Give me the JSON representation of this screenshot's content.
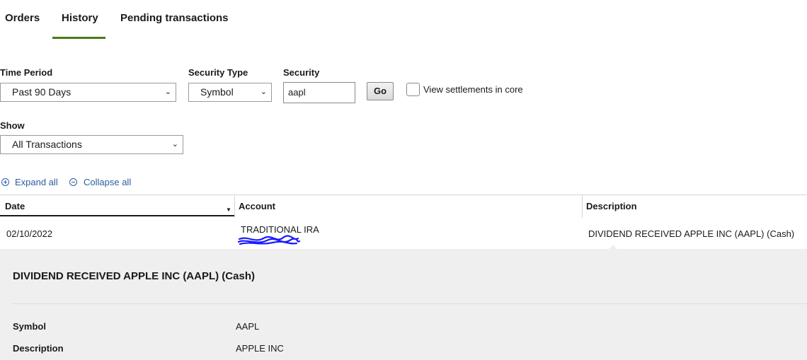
{
  "tabs": [
    {
      "label": "Orders"
    },
    {
      "label": "History",
      "active": true
    },
    {
      "label": "Pending transactions"
    }
  ],
  "filters": {
    "time_period": {
      "label": "Time Period",
      "value": "Past 90 Days"
    },
    "security_type": {
      "label": "Security Type",
      "value": "Symbol"
    },
    "security": {
      "label": "Security",
      "value": "aapl"
    },
    "go_label": "Go",
    "settlements_label": "View settlements in core",
    "show": {
      "label": "Show",
      "value": "All Transactions"
    }
  },
  "expand_all": "Expand all",
  "collapse_all": "Collapse all",
  "table": {
    "headers": [
      "Date",
      "Account",
      "Description"
    ],
    "rows": [
      {
        "date": "02/10/2022",
        "account": "TRADITIONAL IRA",
        "description": "DIVIDEND RECEIVED APPLE INC (AAPL) (Cash)"
      }
    ]
  },
  "detail": {
    "title": "DIVIDEND RECEIVED APPLE INC (AAPL) (Cash)",
    "fields": [
      {
        "label": "Symbol",
        "value": "AAPL"
      },
      {
        "label": "Description",
        "value": "APPLE INC"
      }
    ]
  },
  "colors": {
    "accent": "#4a7a17",
    "link": "#2a5d9f",
    "detail_bg": "#efefef",
    "redaction": "#1a1aff"
  }
}
